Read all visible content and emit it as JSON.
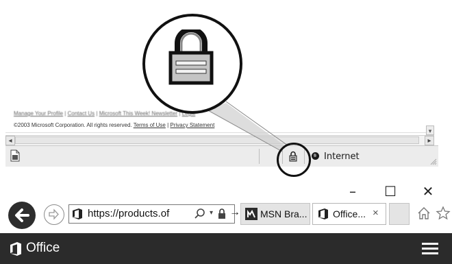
{
  "old_browser": {
    "footer_links": [
      "Manage Your Profile",
      "Contact Us",
      "Microsoft This Week! Newsletter",
      "Legal"
    ],
    "copyright_text": "©2003 Microsoft Corporation. All rights reserved.",
    "terms_link": "Terms of Use",
    "privacy_link": "Privacy Statement",
    "status_zone": "Internet",
    "icons": [
      "page-icon",
      "lock-icon",
      "globe-icon",
      "resize-grip-icon"
    ]
  },
  "new_browser": {
    "window_controls": {
      "minimize": "–",
      "maximize": "☐",
      "close": "✕"
    },
    "address": {
      "url": "https://products.of",
      "go_glyph": "→",
      "dropdown_glyph": "▾"
    },
    "tabs": [
      {
        "label": "MSN Bra...",
        "active": false
      },
      {
        "label": "Office...",
        "active": true,
        "close": "×"
      }
    ],
    "site_title": "Office",
    "colors": {
      "office_bar": "#2b2b2b",
      "back_button": "#2d2d2d",
      "text_on_dark": "#ffffff"
    }
  }
}
